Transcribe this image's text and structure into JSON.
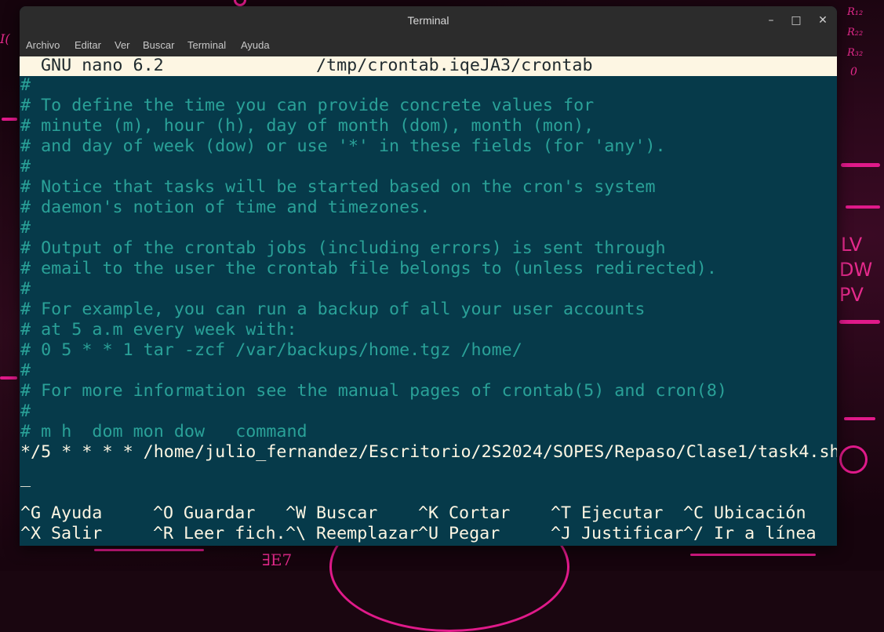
{
  "window": {
    "title": "Terminal",
    "controls": {
      "minimize": "–",
      "maximize": "□",
      "close": "✕"
    }
  },
  "menu": [
    "Archivo",
    "Editar",
    "Ver",
    "Buscar",
    "Terminal",
    "Ayuda"
  ],
  "nano": {
    "version": "GNU nano 6.2",
    "file_path": "/tmp/crontab.iqeJA3/crontab",
    "comment_lines": [
      "#",
      "# To define the time you can provide concrete values for",
      "# minute (m), hour (h), day of month (dom), month (mon),",
      "# and day of week (dow) or use '*' in these fields (for 'any').",
      "#",
      "# Notice that tasks will be started based on the cron's system",
      "# daemon's notion of time and timezones.",
      "#",
      "# Output of the crontab jobs (including errors) is sent through",
      "# email to the user the crontab file belongs to (unless redirected).",
      "#",
      "# For example, you can run a backup of all your user accounts",
      "# at 5 a.m every week with:",
      "# 0 5 * * 1 tar -zcf /var/backups/home.tgz /home/",
      "#",
      "# For more information see the manual pages of crontab(5) and cron(8)",
      "#",
      "# m h  dom mon dow   command"
    ],
    "cron_entry": "*/5 * * * * /home/julio_fernandez/Escritorio/2S2024/SOPES/Repaso/Clase1/task4.sh",
    "cursor": "_",
    "shortcuts_row1": [
      {
        "key": "^G",
        "label": "Ayuda"
      },
      {
        "key": "^O",
        "label": "Guardar"
      },
      {
        "key": "^W",
        "label": "Buscar"
      },
      {
        "key": "^K",
        "label": "Cortar"
      },
      {
        "key": "^T",
        "label": "Ejecutar"
      },
      {
        "key": "^C",
        "label": "Ubicación"
      }
    ],
    "shortcuts_row2": [
      {
        "key": "^X",
        "label": "Salir"
      },
      {
        "key": "^R",
        "label": "Leer fich."
      },
      {
        "key": "^\\",
        "label": "Reemplazar"
      },
      {
        "key": "^U",
        "label": "Pegar"
      },
      {
        "key": "^J",
        "label": "Justificar"
      },
      {
        "key": "^/",
        "label": "Ir a línea"
      }
    ]
  },
  "colors": {
    "terminal_bg": "#063a4a",
    "comment": "#2aa198",
    "text": "#fdf6e3",
    "header_bg": "#fdf6e3",
    "wallpaper_accent": "#e01a8a"
  }
}
